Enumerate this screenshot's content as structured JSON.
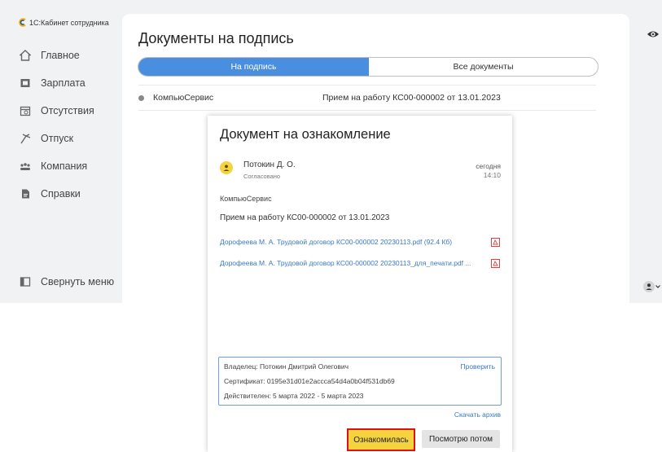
{
  "app": {
    "logo_text": "1С:Кабинет сотрудника"
  },
  "sidebar": {
    "items": [
      {
        "label": "Главное",
        "icon": "home-icon"
      },
      {
        "label": "Зарплата",
        "icon": "salary-icon"
      },
      {
        "label": "Отсутствия",
        "icon": "calendar-icon"
      },
      {
        "label": "Отпуск",
        "icon": "vacation-icon"
      },
      {
        "label": "Компания",
        "icon": "people-icon"
      },
      {
        "label": "Справки",
        "icon": "document-icon"
      }
    ],
    "collapse_label": "Свернуть меню"
  },
  "main": {
    "title": "Документы на подпись",
    "tabs": [
      {
        "label": "На подпись",
        "active": true
      },
      {
        "label": "Все документы",
        "active": false
      }
    ],
    "list": [
      {
        "org": "КомпьюСервис",
        "title": "Прием на работу КС00-000002 от 13.01.2023"
      }
    ]
  },
  "modal": {
    "title": "Документ на ознакомление",
    "person": "Потокин Д. О.",
    "status": "Согласовано",
    "date": "сегодня",
    "time": "14:10",
    "company": "КомпьюСервис",
    "subject": "Прием на работу КС00-000002 от 13.01.2023",
    "files": [
      "Дорофеева М. А. Трудовой договор КС00-000002 20230113.pdf (92.4 Кб)",
      "Дорофеева М. А. Трудовой договор КС00-000002 20230113_для_печати.pdf ..."
    ],
    "certificate": {
      "owner": "Владелец: Потокин Дмитрий Олегович",
      "verify_label": "Проверить",
      "serial": "Сертификат: 0195e31d01e2accca54d4a0b04f531db69",
      "validity": "Действителен: 5 марта 2022 - 5 марта 2023"
    },
    "download_archive": "Скачать архив",
    "acknowledge_label": "Ознакомилась",
    "later_label": "Посмотрю потом"
  },
  "colors": {
    "accent": "#4a8ee0",
    "highlight": "#f5d33f",
    "link": "#3b79c9",
    "outline": "#dd1111"
  }
}
